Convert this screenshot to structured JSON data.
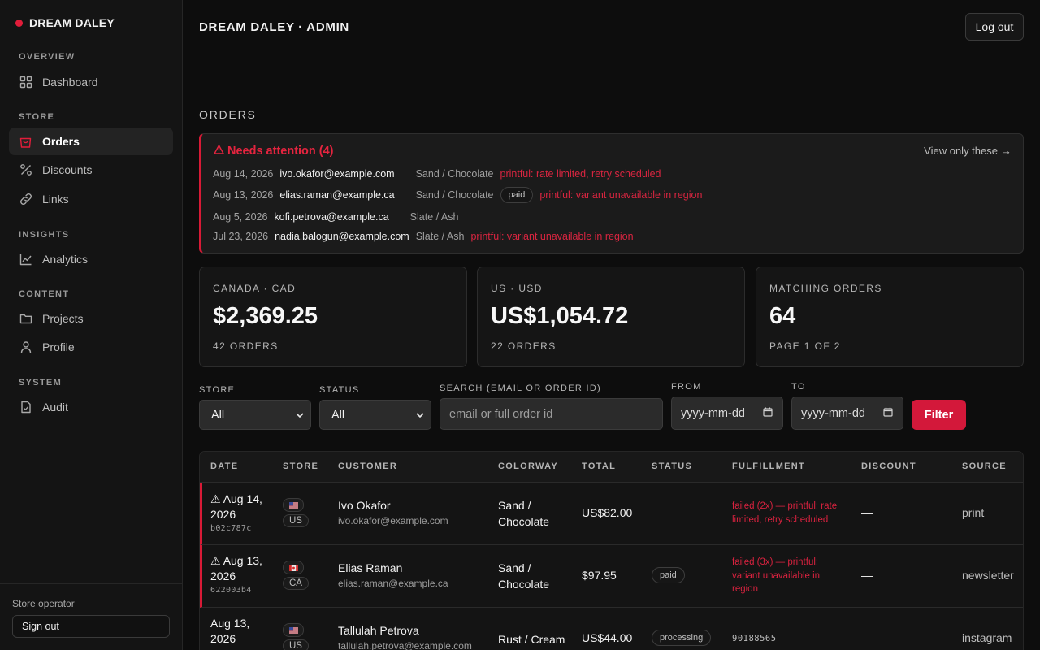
{
  "brand": {
    "name": "DREAM DALEY"
  },
  "sidebar": {
    "sections": [
      {
        "label": "OVERVIEW",
        "items": [
          {
            "label": "Dashboard",
            "icon": "grid-icon"
          }
        ]
      },
      {
        "label": "STORE",
        "items": [
          {
            "label": "Orders",
            "icon": "bag-icon",
            "active": true
          },
          {
            "label": "Discounts",
            "icon": "percent-icon"
          },
          {
            "label": "Links",
            "icon": "link-icon"
          }
        ]
      },
      {
        "label": "INSIGHTS",
        "items": [
          {
            "label": "Analytics",
            "icon": "chart-icon"
          }
        ]
      },
      {
        "label": "CONTENT",
        "items": [
          {
            "label": "Projects",
            "icon": "folder-icon"
          },
          {
            "label": "Profile",
            "icon": "user-icon"
          }
        ]
      },
      {
        "label": "SYSTEM",
        "items": [
          {
            "label": "Audit",
            "icon": "document-check-icon"
          }
        ]
      }
    ],
    "footer": {
      "operator": "Store operator",
      "signout": "Sign out"
    }
  },
  "header": {
    "title": "DREAM DALEY · ADMIN",
    "logout": "Log out"
  },
  "page": {
    "title": "ORDERS"
  },
  "attention": {
    "title": "Needs attention (4)",
    "link": "View only these",
    "rows": [
      {
        "date": "Aug 14, 2026",
        "email": "ivo.okafor@example.com",
        "colorway": "Sand / Chocolate",
        "badge": "",
        "error": "printful: rate limited, retry scheduled"
      },
      {
        "date": "Aug 13, 2026",
        "email": "elias.raman@example.ca",
        "colorway": "Sand / Chocolate",
        "badge": "paid",
        "error": "printful: variant unavailable in region"
      },
      {
        "date": "Aug 5, 2026",
        "email": "kofi.petrova@example.ca",
        "colorway": "Slate / Ash",
        "badge": "",
        "error": ""
      },
      {
        "date": "Jul 23, 2026",
        "email": "nadia.balogun@example.com",
        "colorway": "Slate / Ash",
        "badge": "",
        "error": "printful: variant unavailable in region"
      }
    ]
  },
  "cards": [
    {
      "label": "CANADA · CAD",
      "value": "$2,369.25",
      "sub": "42 ORDERS"
    },
    {
      "label": "US · USD",
      "value": "US$1,054.72",
      "sub": "22 ORDERS"
    },
    {
      "label": "MATCHING ORDERS",
      "value": "64",
      "sub": "PAGE 1 OF 2"
    }
  ],
  "filters": {
    "store_label": "STORE",
    "store_value": "All",
    "status_label": "STATUS",
    "status_value": "All",
    "search_label": "SEARCH (EMAIL OR ORDER ID)",
    "search_placeholder": "email or full order id",
    "from_label": "FROM",
    "from_placeholder": "yyyy-mm-dd",
    "to_label": "TO",
    "to_placeholder": "yyyy-mm-dd",
    "button": "Filter"
  },
  "table": {
    "columns": [
      "DATE",
      "STORE",
      "CUSTOMER",
      "COLORWAY",
      "TOTAL",
      "STATUS",
      "FULFILLMENT",
      "DISCOUNT",
      "SOURCE"
    ],
    "rows": [
      {
        "warn": true,
        "date": "Aug 14, 2026",
        "order_id": "b02c787c",
        "store": "US",
        "flag": "us-flag",
        "name": "Ivo Okafor",
        "email": "ivo.okafor@example.com",
        "colorway": "Sand / Chocolate",
        "total": "US$82.00",
        "status": "",
        "fulfillment": "failed (2x) — printful: rate limited, retry scheduled",
        "fulfillment_error": true,
        "discount": "—",
        "source": "print"
      },
      {
        "warn": true,
        "date": "Aug 13, 2026",
        "order_id": "622003b4",
        "store": "CA",
        "flag": "ca-flag",
        "name": "Elias Raman",
        "email": "elias.raman@example.ca",
        "colorway": "Sand / Chocolate",
        "total": "$97.95",
        "status": "paid",
        "fulfillment": "failed (3x) — printful: variant unavailable in region",
        "fulfillment_error": true,
        "discount": "—",
        "source": "newsletter"
      },
      {
        "warn": false,
        "date": "Aug 13, 2026",
        "order_id": "",
        "store": "US",
        "flag": "us-flag",
        "name": "Tallulah Petrova",
        "email": "tallulah.petrova@example.com",
        "colorway": "Rust / Cream",
        "total": "US$44.00",
        "status": "processing",
        "fulfillment": "90188565",
        "fulfillment_error": false,
        "discount": "—",
        "source": "instagram"
      }
    ]
  },
  "colors": {
    "accent": "#d3183a",
    "background": "#0d0d0d",
    "sidebar": "#141414"
  }
}
